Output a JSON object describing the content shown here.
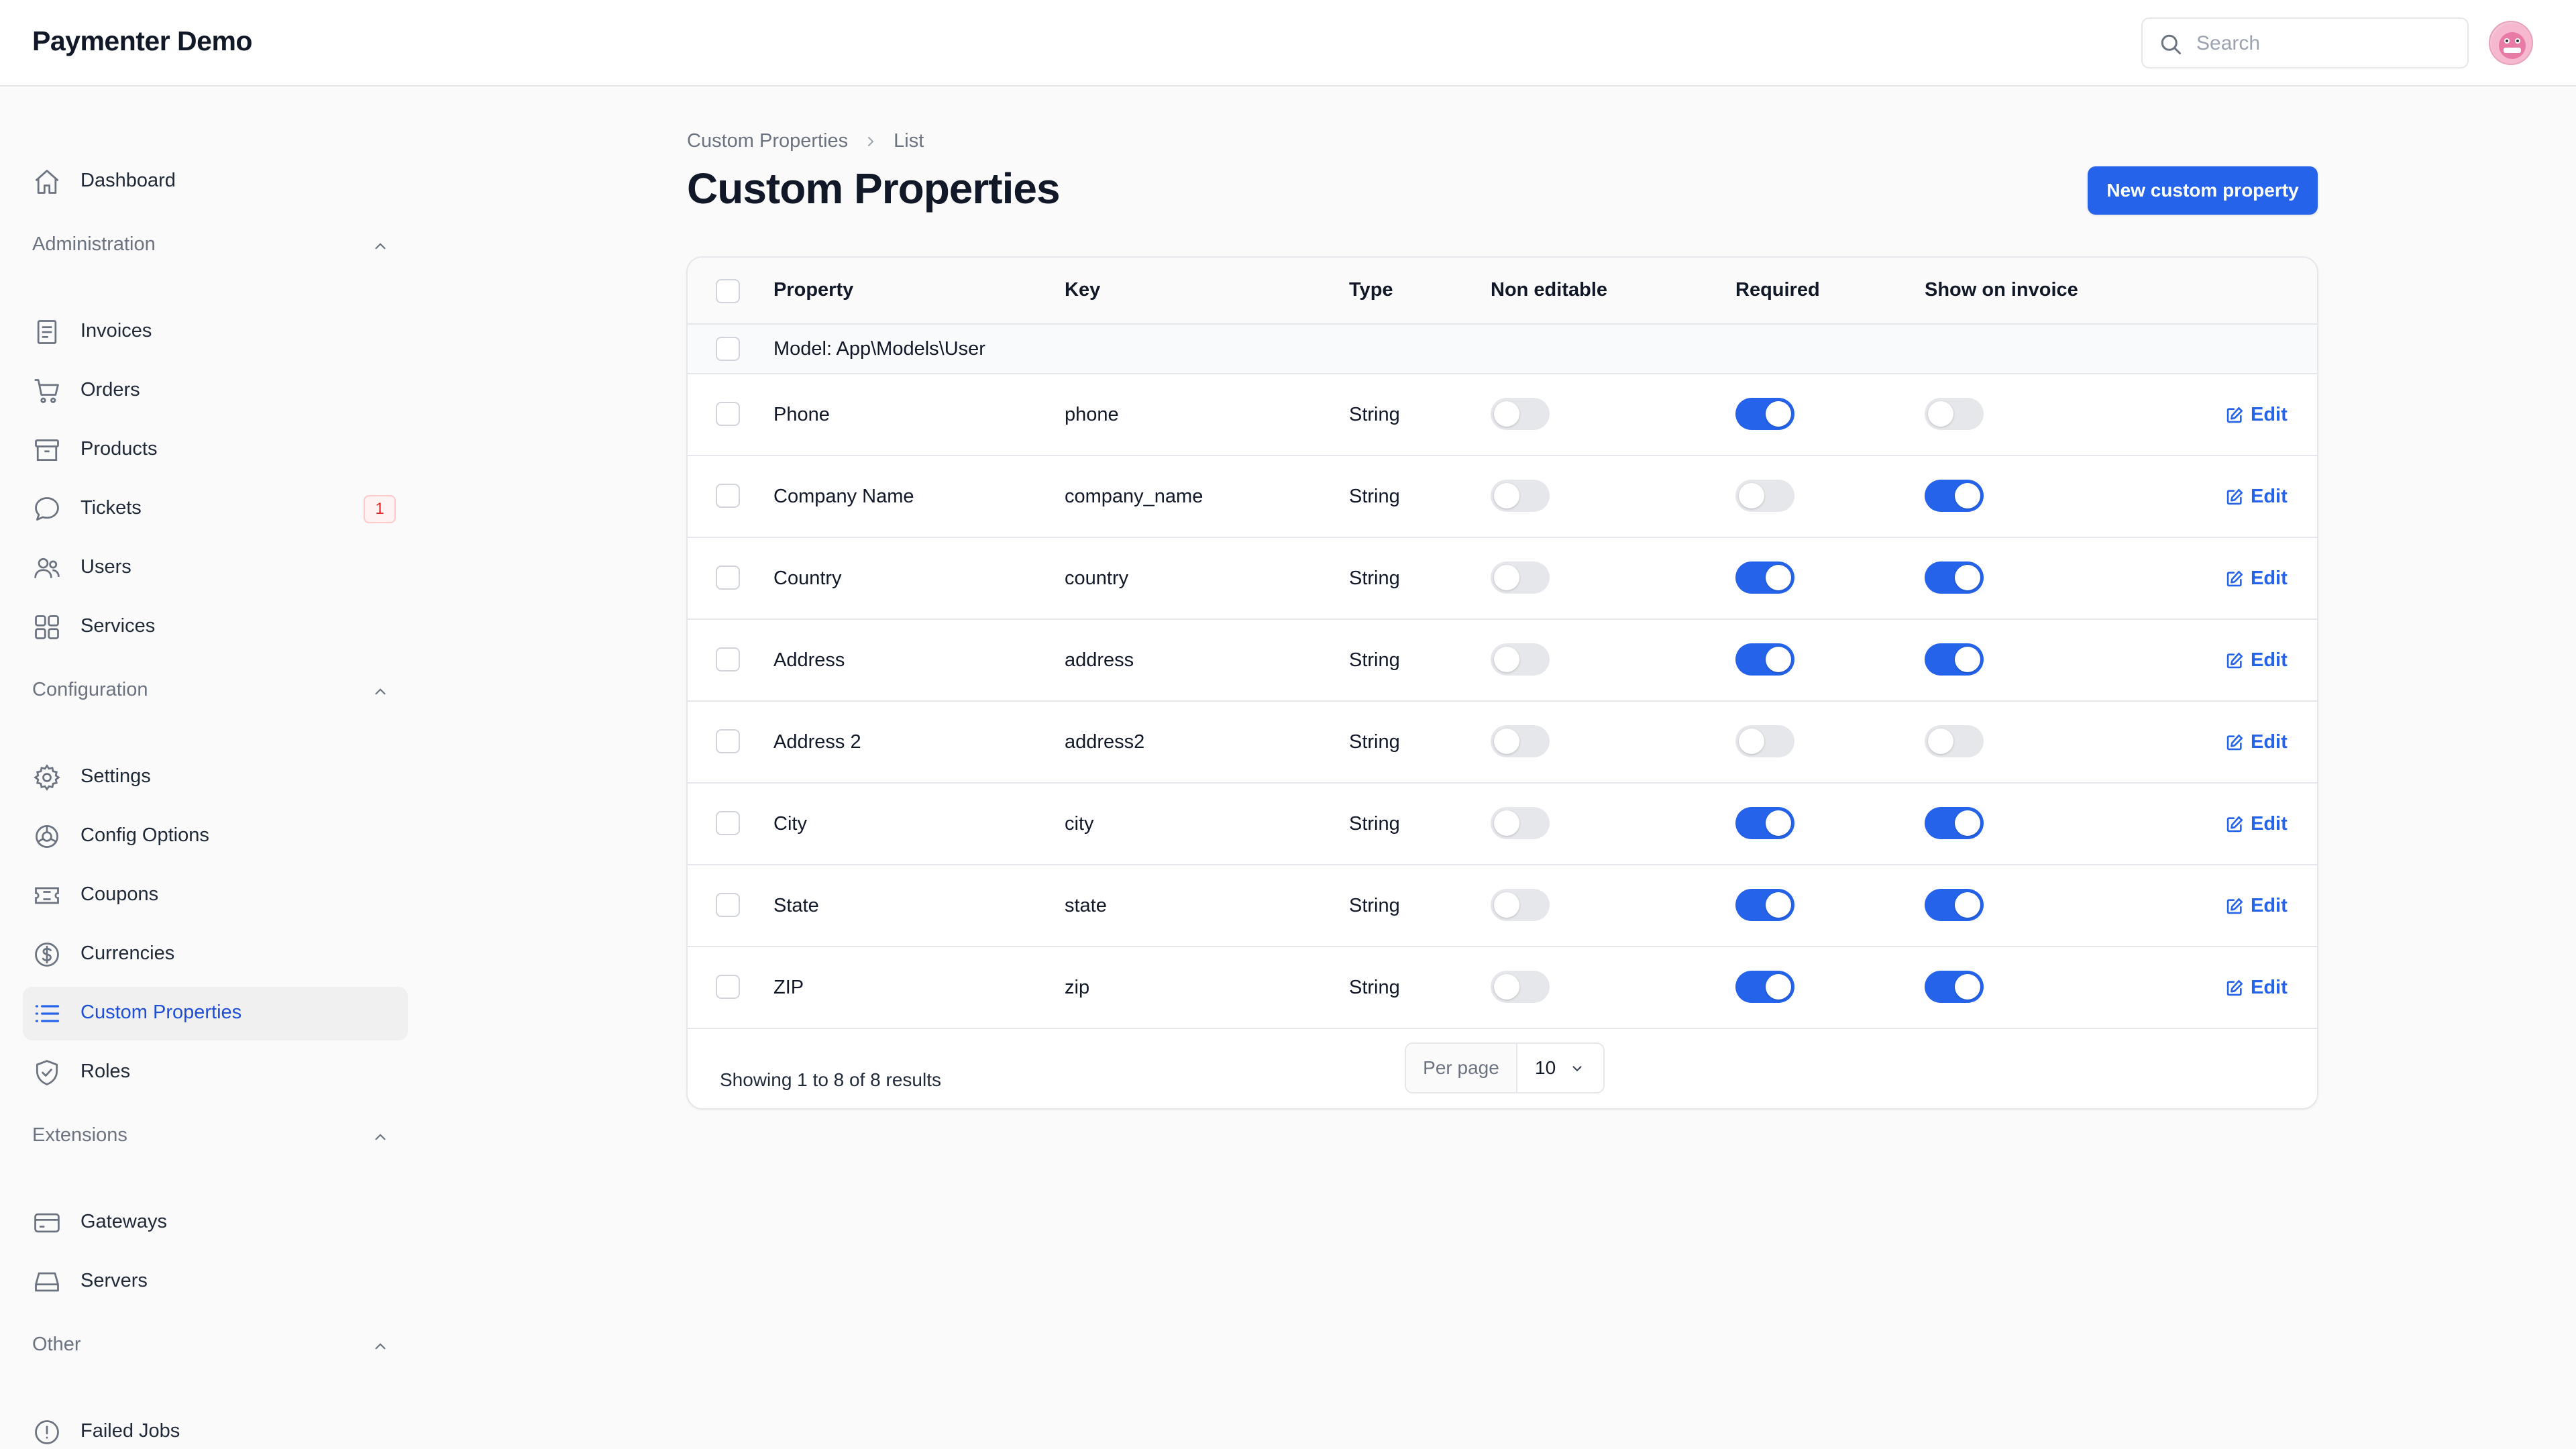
{
  "app": {
    "title": "Paymenter Demo"
  },
  "search": {
    "placeholder": "Search"
  },
  "sidebar": {
    "dashboard": {
      "label": "Dashboard",
      "icon": "home-icon"
    },
    "groups": [
      {
        "title": "Administration",
        "items": [
          {
            "label": "Invoices",
            "icon": "invoice-icon"
          },
          {
            "label": "Orders",
            "icon": "cart-icon"
          },
          {
            "label": "Products",
            "icon": "box-icon"
          },
          {
            "label": "Tickets",
            "icon": "chat-bubble-icon",
            "badge": "1"
          },
          {
            "label": "Users",
            "icon": "users-icon"
          },
          {
            "label": "Services",
            "icon": "grid-icon"
          }
        ]
      },
      {
        "title": "Configuration",
        "items": [
          {
            "label": "Settings",
            "icon": "gear-icon"
          },
          {
            "label": "Config Options",
            "icon": "cog-options-icon"
          },
          {
            "label": "Coupons",
            "icon": "ticket-icon"
          },
          {
            "label": "Currencies",
            "icon": "dollar-circle-icon"
          },
          {
            "label": "Custom Properties",
            "icon": "list-icon",
            "active": true
          },
          {
            "label": "Roles",
            "icon": "shield-check-icon"
          }
        ]
      },
      {
        "title": "Extensions",
        "items": [
          {
            "label": "Gateways",
            "icon": "credit-card-icon"
          },
          {
            "label": "Servers",
            "icon": "server-icon"
          }
        ]
      },
      {
        "title": "Other",
        "items": [
          {
            "label": "Failed Jobs",
            "icon": "exclamation-circle-icon"
          }
        ]
      }
    ]
  },
  "breadcrumb": {
    "parent": "Custom Properties",
    "current": "List"
  },
  "page": {
    "title": "Custom Properties",
    "new_button": "New custom property"
  },
  "table": {
    "columns": [
      "Property",
      "Key",
      "Type",
      "Non editable",
      "Required",
      "Show on invoice"
    ],
    "group_label": "Model: App\\Models\\User",
    "rows": [
      {
        "property": "Phone",
        "key": "phone",
        "type": "String",
        "non_editable": false,
        "required": true,
        "show_on_invoice": false,
        "action": "Edit"
      },
      {
        "property": "Company Name",
        "key": "company_name",
        "type": "String",
        "non_editable": false,
        "required": false,
        "show_on_invoice": true,
        "action": "Edit"
      },
      {
        "property": "Country",
        "key": "country",
        "type": "String",
        "non_editable": false,
        "required": true,
        "show_on_invoice": true,
        "action": "Edit"
      },
      {
        "property": "Address",
        "key": "address",
        "type": "String",
        "non_editable": false,
        "required": true,
        "show_on_invoice": true,
        "action": "Edit"
      },
      {
        "property": "Address 2",
        "key": "address2",
        "type": "String",
        "non_editable": false,
        "required": false,
        "show_on_invoice": false,
        "action": "Edit"
      },
      {
        "property": "City",
        "key": "city",
        "type": "String",
        "non_editable": false,
        "required": true,
        "show_on_invoice": true,
        "action": "Edit"
      },
      {
        "property": "State",
        "key": "state",
        "type": "String",
        "non_editable": false,
        "required": true,
        "show_on_invoice": true,
        "action": "Edit"
      },
      {
        "property": "ZIP",
        "key": "zip",
        "type": "String",
        "non_editable": false,
        "required": true,
        "show_on_invoice": true,
        "action": "Edit"
      }
    ],
    "footer": {
      "summary": "Showing 1 to 8 of 8 results",
      "per_page_label": "Per page",
      "per_page_value": "10"
    }
  },
  "colors": {
    "accent": "#2563eb",
    "toggle_off": "#e5e7eb",
    "badge": "#dc2626"
  }
}
